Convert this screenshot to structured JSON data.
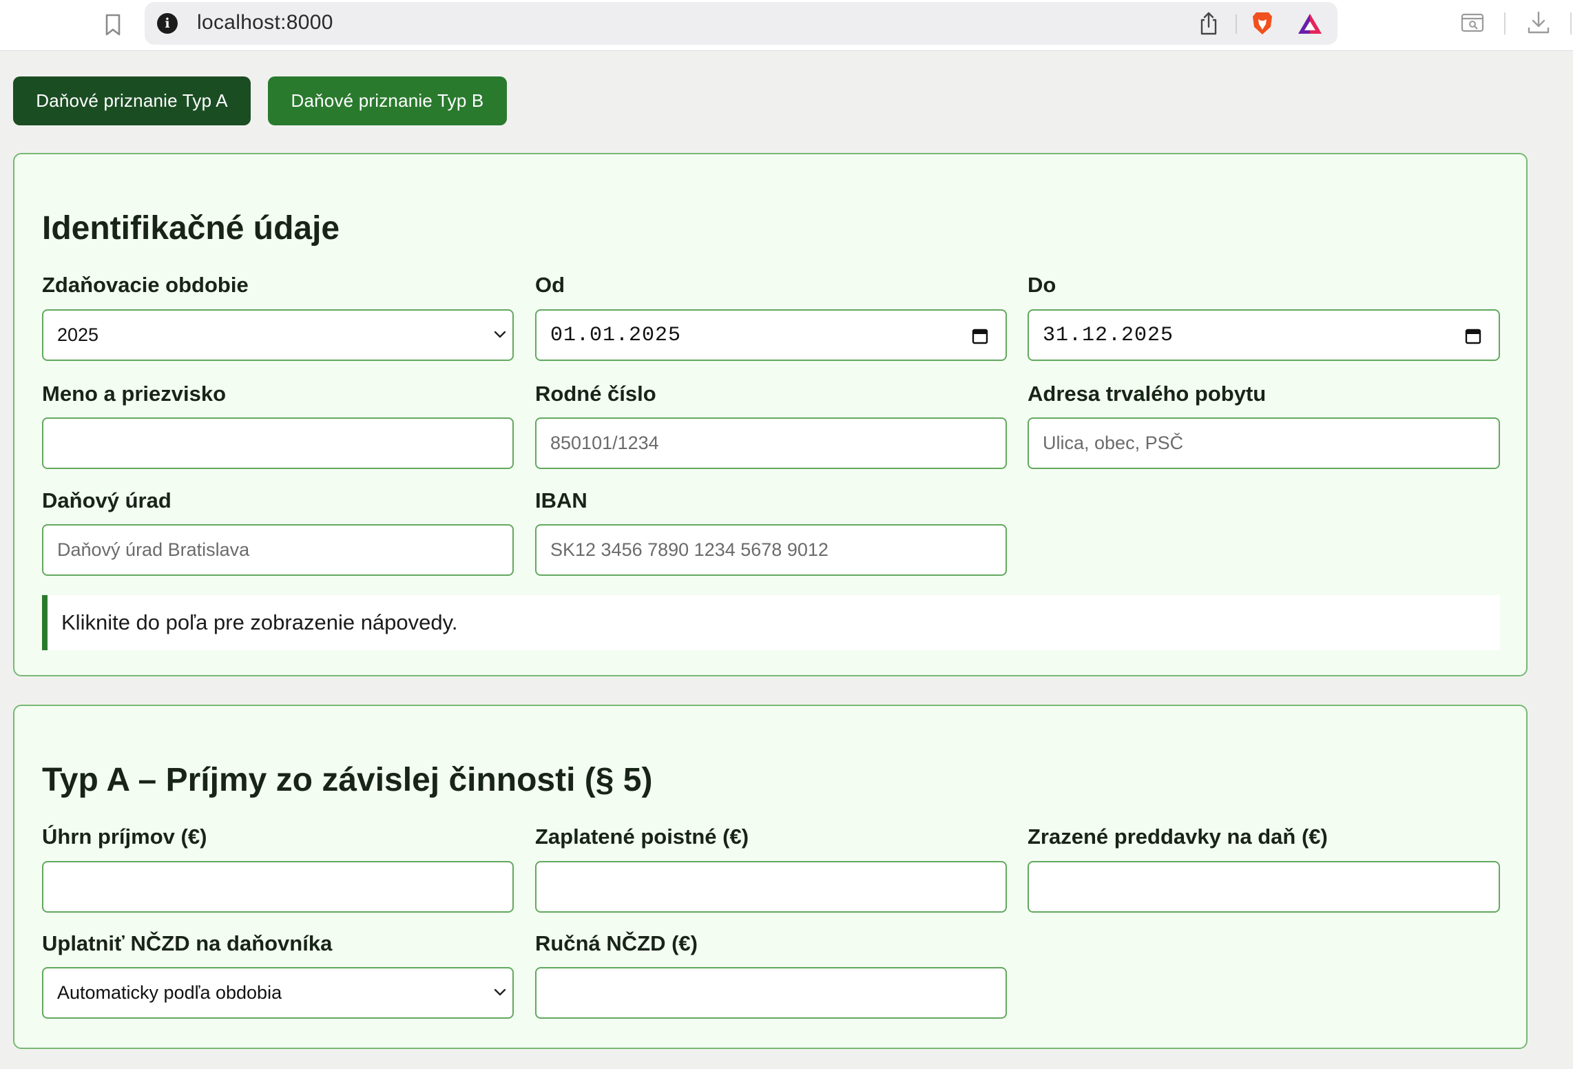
{
  "browser": {
    "url": "localhost:8000"
  },
  "tabs": [
    {
      "label": "Daňové priznanie Typ A"
    },
    {
      "label": "Daňové priznanie Typ B"
    }
  ],
  "identification": {
    "title": "Identifikačné údaje",
    "period": {
      "label": "Zdaňovacie obdobie",
      "value": "2025"
    },
    "from": {
      "label": "Od",
      "value": "01.01.2025"
    },
    "to": {
      "label": "Do",
      "value": "31.12.2025"
    },
    "name": {
      "label": "Meno a priezvisko",
      "value": "",
      "placeholder": ""
    },
    "birth_number": {
      "label": "Rodné číslo",
      "value": "",
      "placeholder": "850101/1234"
    },
    "address": {
      "label": "Adresa trvalého pobytu",
      "value": "",
      "placeholder": "Ulica, obec, PSČ"
    },
    "tax_office": {
      "label": "Daňový úrad",
      "value": "",
      "placeholder": "Daňový úrad Bratislava"
    },
    "iban": {
      "label": "IBAN",
      "value": "",
      "placeholder": "SK12 3456 7890 1234 5678 9012"
    },
    "hint": "Kliknite do poľa pre zobrazenie nápovedy."
  },
  "type_a": {
    "title": "Typ A – Príjmy zo závislej činnosti (§ 5)",
    "income": {
      "label": "Úhrn príjmov (€)",
      "value": ""
    },
    "insurance": {
      "label": "Zaplatené poistné (€)",
      "value": ""
    },
    "advances": {
      "label": "Zrazené preddavky na daň (€)",
      "value": ""
    },
    "nczd": {
      "label": "Uplatniť NČZD na daňovníka",
      "value": "Automaticky podľa obdobia"
    },
    "manual_nczd": {
      "label": "Ručná NČZD (€)",
      "value": ""
    }
  },
  "colors": {
    "tab_active": "#1b4d23",
    "tab": "#2a7a2e",
    "card_bg": "#f3fdf2",
    "card_border": "#78b874",
    "input_border": "#62a85e"
  },
  "icons": [
    "bookmark-icon",
    "info-icon",
    "share-icon",
    "brave-lion-icon",
    "brave-rewards-icon",
    "reader-mode-icon",
    "download-icon",
    "calendar-icon",
    "chevron-down-icon"
  ]
}
